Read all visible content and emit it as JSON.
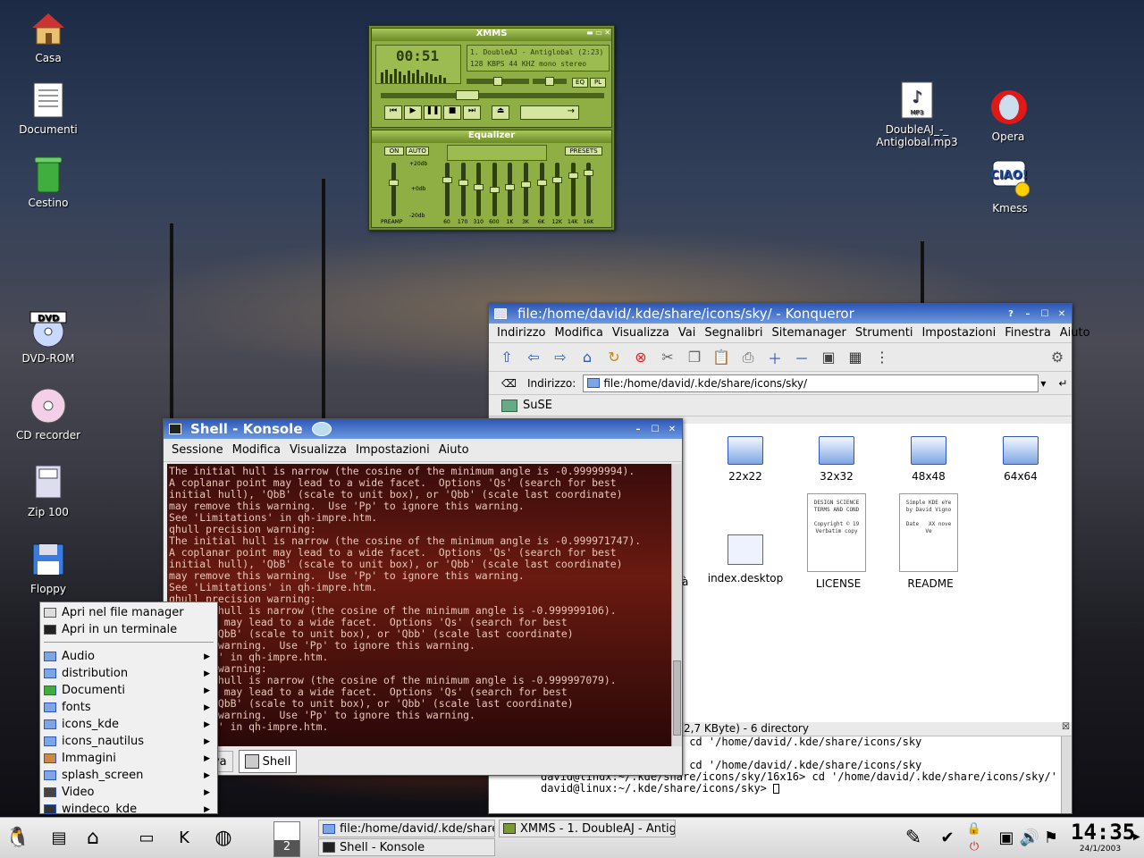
{
  "desktop": {
    "icons": [
      {
        "label": "Casa"
      },
      {
        "label": "Documenti"
      },
      {
        "label": "Cestino"
      },
      {
        "label": "DVD-ROM"
      },
      {
        "label": "CD recorder"
      },
      {
        "label": "Zip 100"
      },
      {
        "label": "Floppy"
      },
      {
        "label": "DoubleAJ_-_\nAntiglobal.mp3"
      },
      {
        "label": "Opera"
      },
      {
        "label": "Kmess"
      }
    ]
  },
  "xmms": {
    "title": "XMMS",
    "time": "00:51",
    "track": "1. DoubleAJ - Antiglobal (2:23)",
    "bitrate": "128",
    "kbps": "KBPS",
    "khz_value": "44",
    "khz": "KHZ",
    "mono": "mono",
    "stereo": "stereo",
    "eq_btn": "EQ",
    "pl_btn": "PL",
    "equalizer_title": "Equalizer",
    "on_btn": "ON",
    "auto_btn": "AUTO",
    "presets_btn": "PRESETS",
    "db_top": "+20db",
    "db_mid": "+0db",
    "db_bot": "-20db",
    "preamp": "PREAMP",
    "preamp_level": 0.35,
    "bands": [
      {
        "label": "60",
        "level": 0.3
      },
      {
        "label": "170",
        "level": 0.35
      },
      {
        "label": "310",
        "level": 0.45
      },
      {
        "label": "600",
        "level": 0.5
      },
      {
        "label": "1K",
        "level": 0.45
      },
      {
        "label": "3K",
        "level": 0.4
      },
      {
        "label": "6K",
        "level": 0.35
      },
      {
        "label": "12K",
        "level": 0.3
      },
      {
        "label": "14K",
        "level": 0.2
      },
      {
        "label": "16K",
        "level": 0.15
      }
    ]
  },
  "konqueror": {
    "title": "file:/home/david/.kde/share/icons/sky/ - Konqueror",
    "menu": [
      "Indirizzo",
      "Modifica",
      "Visualizza",
      "Vai",
      "Segnalibri",
      "Sitemanager",
      "Strumenti",
      "Impostazioni",
      "Finestra",
      "Aiuto"
    ],
    "location_label": "Indirizzo:",
    "location_value": "file:/home/david/.kde/share/icons/sky/",
    "bookmark": "SuSE",
    "folders": [
      "22x22",
      "32x32",
      "48x48",
      "64x64"
    ],
    "files": [
      "index.desktop",
      "LICENSE",
      "README"
    ],
    "file_partial": "à",
    "license_text": "DESIGN SCIENCE\nTERMS AND COND\n\nCopyright © 19\nVerbatim copy",
    "readme_text": "Simple KDE eYe\nby David Vigno\n\nDate   XX nove\nVe",
    "status": "2,7 KByte) - 6 directory",
    "terminal_lines": [
      "sky/32x32/filesystems> cd '/home/david/.kde/share/icons/sky",
      "",
      "sky/16x16/filesystems> cd '/home/david/.kde/share/icons/sky",
      "david@linux:~/.kde/share/icons/sky/16x16> cd '/home/david/.kde/share/icons/sky/'",
      "david@linux:~/.kde/share/icons/sky> "
    ]
  },
  "konsole": {
    "title": "Shell - Konsole",
    "menu": [
      "Sessione",
      "Modifica",
      "Visualizza",
      "Impostazioni",
      "Aiuto"
    ],
    "lines": [
      "The initial hull is narrow (the cosine of the minimum angle is -0.99999994).",
      "A coplanar point may lead to a wide facet.  Options 'Qs' (search for best",
      "initial hull), 'QbB' (scale to unit box), or 'Qbb' (scale last coordinate)",
      "may remove this warning.  Use 'Pp' to ignore this warning.",
      "See 'Limitations' in qh-impre.htm.",
      "qhull precision warning:",
      "The initial hull is narrow (the cosine of the minimum angle is -0.999971747).",
      "A coplanar point may lead to a wide facet.  Options 'Qs' (search for best",
      "initial hull), 'QbB' (scale to unit box), or 'Qbb' (scale last coordinate)",
      "may remove this warning.  Use 'Pp' to ignore this warning.",
      "See 'Limitations' in qh-impre.htm.",
      "qhull precision warning:",
      "initial hull is narrow (the cosine of the minimum angle is -0.999999106).",
      "ar point may lead to a wide facet.  Options 'Qs' (search for best",
      "hull), 'QbB' (scale to unit box), or 'Qbb' (scale last coordinate)",
      "ve this warning.  Use 'Pp' to ignore this warning.",
      "itations' in qh-impre.htm.",
      "ecision warning:",
      "initial hull is narrow (the cosine of the minimum angle is -0.999997079).",
      "ar point may lead to a wide facet.  Options 'Qs' (search for best",
      "hull), 'QbB' (scale to unit box), or 'Qbb' (scale last coordinate)",
      "ve this warning.  Use 'Pp' to ignore this warning.",
      "itations' in qh-impre.htm.",
      "nux:~> "
    ],
    "tab_new": "ova",
    "tab_shell": "Shell"
  },
  "context_menu": {
    "top_items": [
      "Apri nel file manager",
      "Apri in un terminale"
    ],
    "folders": [
      "Audio",
      "distribution",
      "Documenti",
      "fonts",
      "icons_kde",
      "icons_nautilus",
      "Immagini",
      "splash_screen",
      "Video",
      "windeco_kde"
    ]
  },
  "taskbar": {
    "desk_number": "2",
    "tasks": [
      "file:/home/david/.kde/share",
      "XMMS - 1. DoubleAJ - Antigl",
      "Shell - Konsole"
    ],
    "clock_time": "14:35",
    "clock_date": "24/1/2003"
  }
}
